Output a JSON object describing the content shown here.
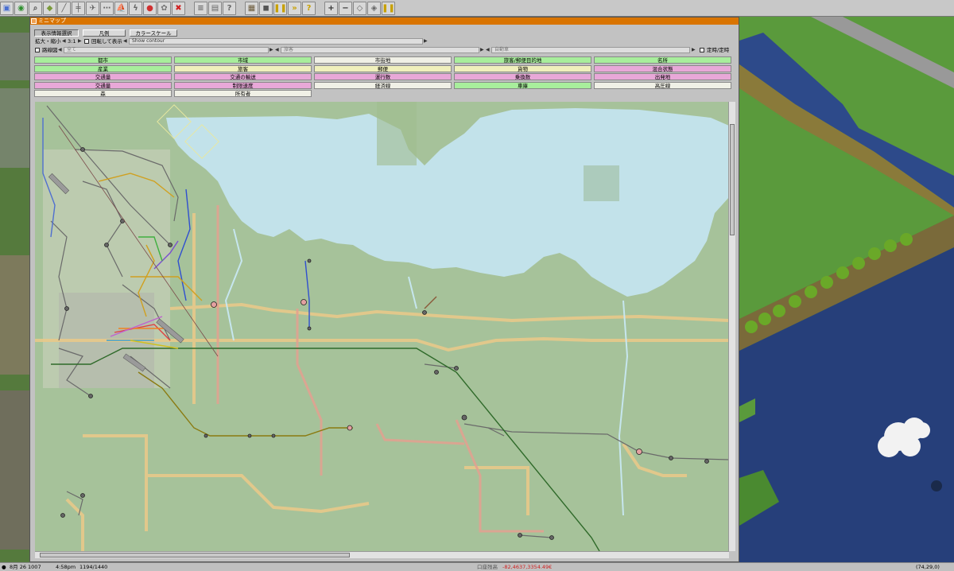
{
  "toolbar": {
    "tools": [
      {
        "icon": "save-icon",
        "color": "#4a6fd1"
      },
      {
        "icon": "globe-icon",
        "color": "#2f8f2f"
      },
      {
        "icon": "magnifier-icon",
        "color": "#555555"
      },
      {
        "icon": "terrain-icon",
        "color": "#7a9a3a"
      },
      {
        "icon": "road-icon",
        "color": "#666666"
      },
      {
        "icon": "rail-icon",
        "color": "#666666"
      },
      {
        "icon": "airport-icon",
        "color": "#666666"
      },
      {
        "icon": "tram-icon",
        "color": "#666666"
      },
      {
        "icon": "ship-icon",
        "color": "#666666"
      },
      {
        "icon": "powerline-icon",
        "color": "#666666"
      },
      {
        "icon": "stop-icon",
        "color": "#d03030"
      },
      {
        "icon": "special-icon",
        "color": "#777777"
      },
      {
        "icon": "delete-icon",
        "color": "#d02020"
      }
    ],
    "tools2": [
      {
        "icon": "list-icon",
        "color": "#666666"
      },
      {
        "icon": "finance-icon",
        "color": "#666666"
      },
      {
        "icon": "help-icon",
        "color": "#666666"
      }
    ],
    "tools3": [
      {
        "icon": "minimap-icon",
        "color": "#6b5a3a"
      },
      {
        "icon": "camera-icon",
        "color": "#555555"
      },
      {
        "icon": "pause-icon",
        "color": "#c8a000"
      },
      {
        "icon": "fastforward-icon",
        "color": "#c8a000"
      },
      {
        "icon": "question-icon",
        "color": "#c8a000"
      }
    ],
    "tools4": [
      {
        "icon": "zoom-in-icon",
        "color": "#333333"
      },
      {
        "icon": "zoom-out-icon",
        "color": "#333333"
      },
      {
        "icon": "grid-icon",
        "color": "#666666"
      },
      {
        "icon": "layers-icon",
        "color": "#666666"
      },
      {
        "icon": "pause2-icon",
        "color": "#c8a000"
      }
    ]
  },
  "map_window": {
    "title": "ミニマップ",
    "buttons": {
      "display_select": "表示情報選択",
      "legend": "凡例",
      "color_scale": "カラースケール"
    },
    "zoom_label": "拡大・縮小",
    "zoom_value": "3:1",
    "rotate_label": "回転して表示",
    "contour_label": "Show contour",
    "filter_label": "路線図",
    "filter_all": "全て",
    "filter_freight": "旅客",
    "filter_vehicle": "自動車",
    "schedule_label": "定時/定時",
    "legend_items": [
      {
        "label": "都市",
        "color": "#a8ee9c"
      },
      {
        "label": "市域",
        "color": "#a8ee9c"
      },
      {
        "label": "市街地",
        "color": "#f0f0e6"
      },
      {
        "label": "旅客/郵便目的地",
        "color": "#a8ee9c"
      },
      {
        "label": "名所",
        "color": "#a8ee9c"
      },
      {
        "label": "産業",
        "color": "#a8ee9c"
      },
      {
        "label": "旅客",
        "color": "#f0f0bc"
      },
      {
        "label": "郵便",
        "color": "#f0f0bc"
      },
      {
        "label": "貨物",
        "color": "#f0f0bc"
      },
      {
        "label": "混合状態",
        "color": "#e8a8d8"
      },
      {
        "label": "交通量",
        "color": "#e8a8d8"
      },
      {
        "label": "交通の輸送",
        "color": "#e8a8d8"
      },
      {
        "label": "運行数",
        "color": "#e8a8d8"
      },
      {
        "label": "乗換数",
        "color": "#e8a8d8"
      },
      {
        "label": "出発地",
        "color": "#e8a8d8"
      },
      {
        "label": "交通量",
        "color": "#e8a8d8"
      },
      {
        "label": "制限速度",
        "color": "#e8a8d8"
      },
      {
        "label": "経済線",
        "color": "#f0f0e6"
      },
      {
        "label": "車庫",
        "color": "#a8ee9c"
      },
      {
        "label": "高圧線",
        "color": "#f0f0e6"
      },
      {
        "label": "森",
        "color": "#f0f0e6"
      },
      {
        "label": "所有者",
        "color": "#f0f0e6"
      }
    ]
  },
  "status_bar": {
    "date": "8月 26 1007",
    "time": "4:58pm",
    "population": "1194/1440",
    "money_label": "口座残高",
    "money": "-82,4637,3354.49€",
    "coords": "(74,29,0)"
  },
  "colors": {
    "title_bar": "#d97400",
    "water": "#c2e2ea",
    "land": "#a6c29a"
  }
}
